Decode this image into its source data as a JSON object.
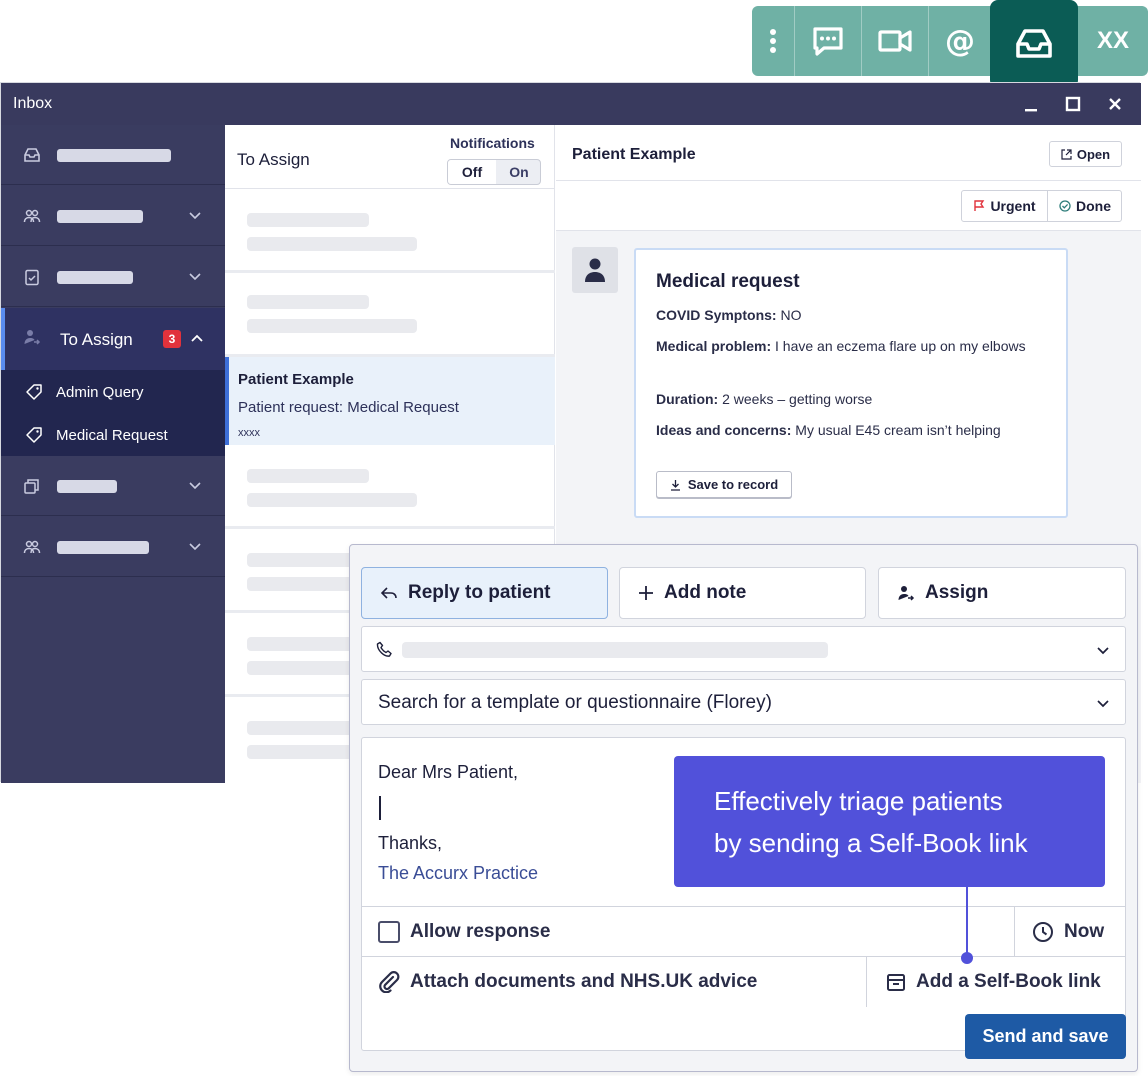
{
  "toolbar": {
    "icons": [
      "more-vertical-icon",
      "chat-icon",
      "video-icon",
      "at-icon",
      "inbox-icon"
    ],
    "user_initials": "XX",
    "accent": "#6fb1a5",
    "active": "#0b5c55"
  },
  "window": {
    "title": "Inbox",
    "controls": [
      "minimize-icon",
      "maximize-icon",
      "close-icon"
    ]
  },
  "sidebar": {
    "active_item": {
      "label": "To Assign",
      "badge": "3",
      "children": [
        {
          "label": "Admin Query"
        },
        {
          "label": "Medical Request"
        }
      ]
    }
  },
  "list": {
    "title": "To Assign",
    "notifications_label": "Notifications",
    "toggle": {
      "off": "Off",
      "on": "On",
      "selected": "Off"
    },
    "selected_item": {
      "name": "Patient Example",
      "request": "Patient request: Medical Request",
      "extra": "xxxx"
    }
  },
  "detail": {
    "patient_name": "Patient Example",
    "open_label": "Open",
    "urgent_label": "Urgent",
    "done_label": "Done",
    "card": {
      "heading": "Medical request",
      "fields": [
        {
          "label": "COVID Symptons:",
          "value": "NO"
        },
        {
          "label": "Medical problem:",
          "value": "I have an eczema flare up on my elbows"
        },
        {
          "label": "Duration:",
          "value": "2 weeks – getting worse"
        },
        {
          "label": "Ideas and concerns:",
          "value": "My usual E45 cream isn’t helping"
        }
      ],
      "save_label": "Save to record"
    }
  },
  "reply": {
    "tabs": [
      {
        "label": "Reply to patient"
      },
      {
        "label": "Add note"
      },
      {
        "label": "Assign"
      }
    ],
    "template_placeholder": "Search for a template or questionnaire (Florey)",
    "message": {
      "greeting": "Dear Mrs Patient,",
      "sign_off": "Thanks,",
      "signature": "The Accurx Practice"
    },
    "allow_response_label": "Allow response",
    "schedule_label": "Now",
    "attach_label": "Attach documents and NHS.UK advice",
    "selfbook_label": "Add a Self-Book link",
    "send_label": "Send and save"
  },
  "callout": {
    "line1": "Effectively triage patients",
    "line2": "by sending a Self-Book link",
    "color": "#5151da"
  }
}
